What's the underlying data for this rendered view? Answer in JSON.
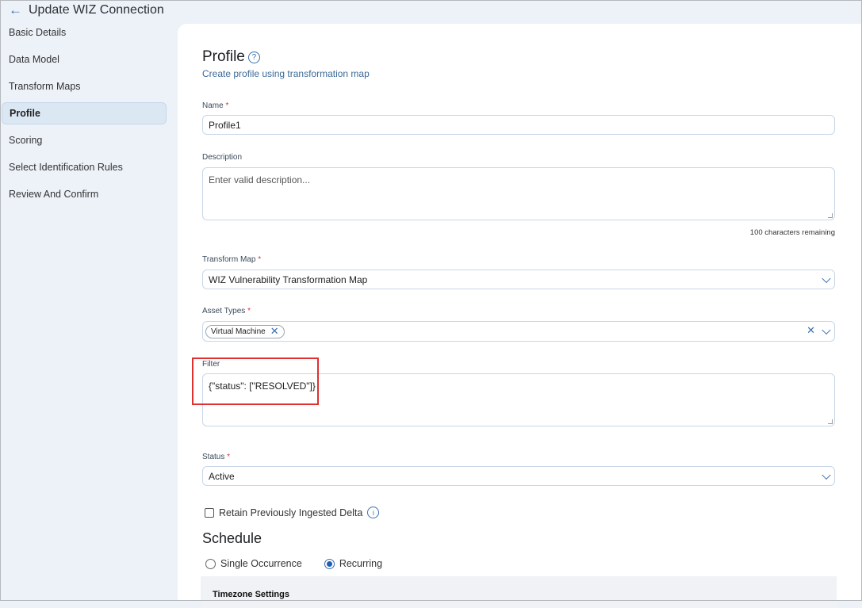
{
  "header": {
    "title": "Update WIZ Connection"
  },
  "sidebar": {
    "items": [
      {
        "label": "Basic Details"
      },
      {
        "label": "Data Model"
      },
      {
        "label": "Transform Maps"
      },
      {
        "label": "Profile"
      },
      {
        "label": "Scoring"
      },
      {
        "label": "Select Identification Rules"
      },
      {
        "label": "Review And Confirm"
      }
    ],
    "active": "Profile"
  },
  "form": {
    "title": "Profile",
    "subtitle": "Create profile using transformation map",
    "name": {
      "label": "Name",
      "value": "Profile1"
    },
    "description": {
      "label": "Description",
      "placeholder": "Enter valid description...",
      "remaining": "100 characters remaining"
    },
    "transform_map": {
      "label": "Transform Map",
      "value": "WIZ Vulnerability Transformation Map"
    },
    "asset_types": {
      "label": "Asset Types",
      "chips": [
        "Virtual Machine"
      ]
    },
    "filter": {
      "label": "Filter",
      "value": "{\"status\": [\"RESOLVED\"]}"
    },
    "status": {
      "label": "Status",
      "value": "Active"
    },
    "retain": {
      "label": "Retain Previously Ingested Delta",
      "checked": false
    },
    "schedule": {
      "title": "Schedule",
      "options": [
        "Single Occurrence",
        "Recurring"
      ],
      "selected": "Recurring",
      "timezone_title": "Timezone Settings"
    },
    "required_mark": "*"
  }
}
